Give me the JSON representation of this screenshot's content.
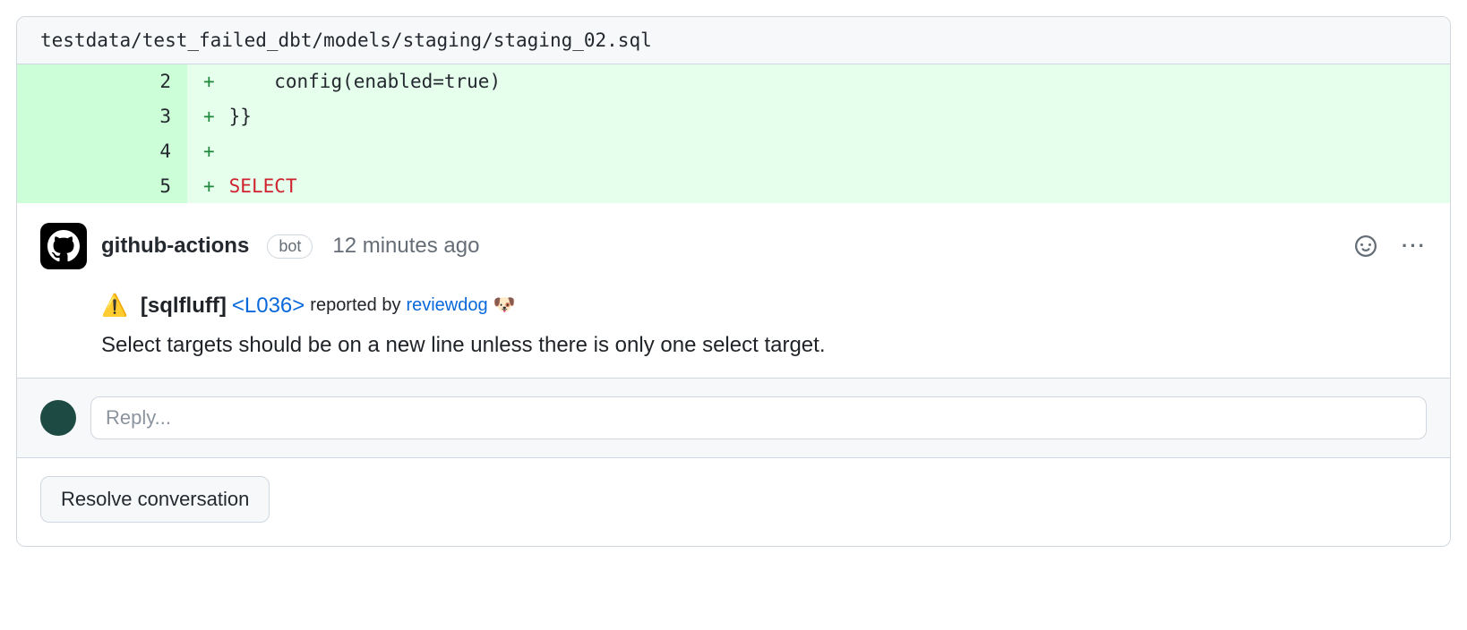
{
  "file_path": "testdata/test_failed_dbt/models/staging/staging_02.sql",
  "diff": {
    "lines": [
      {
        "num": "2",
        "marker": "+",
        "indent": "    ",
        "code": "config(enabled=true)"
      },
      {
        "num": "3",
        "marker": "+",
        "indent": "",
        "code": "}}"
      },
      {
        "num": "4",
        "marker": "+",
        "indent": "",
        "code": ""
      },
      {
        "num": "5",
        "marker": "+",
        "indent": "",
        "keyword": "SELECT"
      }
    ]
  },
  "comment": {
    "author": "github-actions",
    "bot_label": "bot",
    "timestamp": "12 minutes ago",
    "warn_emoji": "⚠️",
    "tool": "[sqlfluff]",
    "rule_open": "<",
    "rule": "L036",
    "rule_close": ">",
    "reported_prefix": "reported by",
    "reviewer": "reviewdog",
    "dog_emoji": "🐶",
    "message": "Select targets should be on a new line unless there is only one select target."
  },
  "reply": {
    "placeholder": "Reply..."
  },
  "actions": {
    "resolve": "Resolve conversation"
  }
}
